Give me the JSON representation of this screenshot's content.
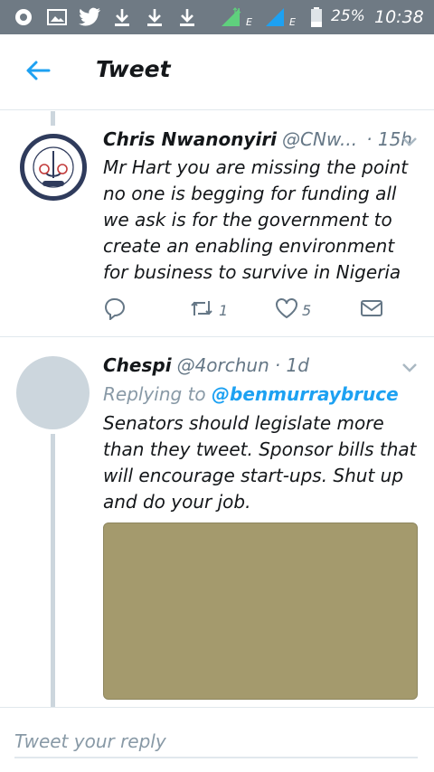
{
  "status_bar": {
    "battery": "25%",
    "time": "10:38",
    "network_badge_1": "E",
    "network_badge_2": "E",
    "icons": [
      "circle-notification-icon",
      "image-icon",
      "twitter-bird-icon",
      "download-icon",
      "download-icon",
      "download-icon",
      "signal-icon",
      "signal-icon",
      "battery-icon"
    ]
  },
  "header": {
    "title": "Tweet",
    "back_icon": "back-arrow-icon"
  },
  "tweets": [
    {
      "name": "Chris Nwanonyiri",
      "handle": "@CNw...",
      "time": "· 15h",
      "text": "Mr Hart you are missing the point no one is begging for funding all we ask is for the government to create an enabling environment for business to survive in Nigeria",
      "retweets": "1",
      "likes": "5",
      "avatar_icon": "anchor-american-exports-logo-icon"
    },
    {
      "name": "Chespi",
      "handle": "@4orchun",
      "time": "· 1d",
      "replying_label": "Replying to",
      "replying_to": "@benmurraybruce",
      "text": "Senators should legislate more than they tweet. Sponsor bills that will encourage start-ups. Shut up and do your job."
    }
  ],
  "reply": {
    "placeholder": "Tweet your reply"
  },
  "colors": {
    "accent": "#1da1f2",
    "statusbar": "#6f7a84",
    "thread_line": "#ccd6dd",
    "media": "#a49a6d"
  }
}
